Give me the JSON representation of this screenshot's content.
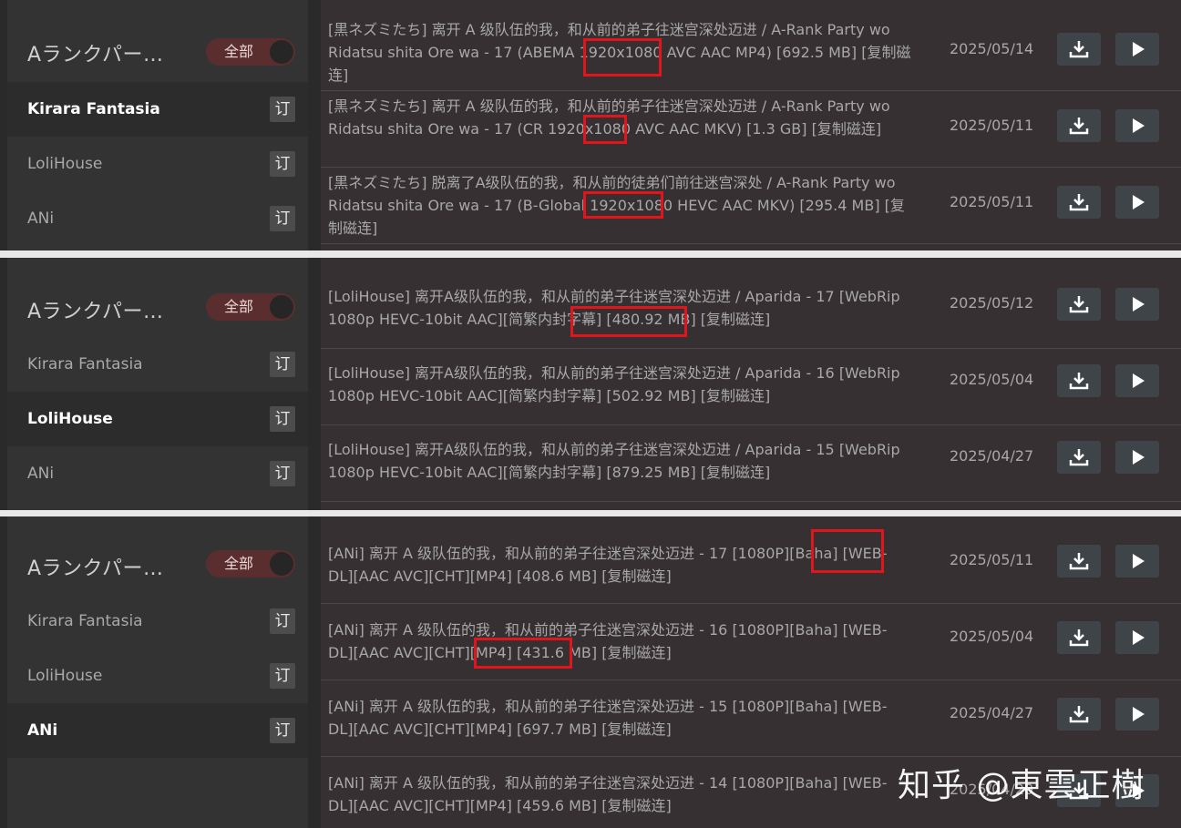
{
  "panels": [
    {
      "sidebar": {
        "title": "Aランクパー…",
        "toggle_label": "全部",
        "items": [
          {
            "label": "Kirara Fantasia",
            "sub": "订"
          },
          {
            "label": "LoliHouse",
            "sub": "订"
          },
          {
            "label": "ANi",
            "sub": "订"
          }
        ],
        "active_index": 0
      },
      "rows": [
        {
          "title": "[黒ネズミたち] 离开 A 级队伍的我，和从前的弟子往迷宫深处迈进 / A-Rank Party wo Ridatsu shita Ore wa - 17 (ABEMA 1920x1080 AVC AAC MP4) [692.5 MB] [复制磁连]",
          "date": "2025/05/14"
        },
        {
          "title": "[黒ネズミたち] 离开 A 级队伍的我，和从前的弟子往迷宫深处迈进 / A-Rank Party wo Ridatsu shita Ore wa - 17 (CR 1920x1080 AVC AAC MKV) [1.3 GB] [复制磁连]",
          "date": "2025/05/11"
        },
        {
          "title": "[黒ネズミたち] 脱离了A级队伍的我，和从前的徒弟们前往迷宫深处 / A-Rank Party wo Ridatsu shita Ore wa - 17 (B-Global 1920x1080 HEVC AAC MKV) [295.4 MB] [复制磁连]",
          "date": "2025/05/11"
        }
      ]
    },
    {
      "sidebar": {
        "title": "Aランクパー…",
        "toggle_label": "全部",
        "items": [
          {
            "label": "Kirara Fantasia",
            "sub": "订"
          },
          {
            "label": "LoliHouse",
            "sub": "订"
          },
          {
            "label": "ANi",
            "sub": "订"
          }
        ],
        "active_index": 1
      },
      "rows": [
        {
          "title": "[LoliHouse] 离开A级队伍的我，和从前的弟子往迷宫深处迈进 / Aparida - 17 [WebRip 1080p HEVC-10bit AAC][简繁内封字幕] [480.92 MB] [复制磁连]",
          "date": "2025/05/12"
        },
        {
          "title": "[LoliHouse] 离开A级队伍的我，和从前的弟子往迷宫深处迈进 / Aparida - 16 [WebRip 1080p HEVC-10bit AAC][简繁内封字幕] [502.92 MB] [复制磁连]",
          "date": "2025/05/04"
        },
        {
          "title": "[LoliHouse] 离开A级队伍的我，和从前的弟子往迷宫深处迈进 / Aparida - 15 [WebRip 1080p HEVC-10bit AAC][简繁内封字幕] [879.25 MB] [复制磁连]",
          "date": "2025/04/27"
        }
      ]
    },
    {
      "sidebar": {
        "title": "Aランクパー…",
        "toggle_label": "全部",
        "items": [
          {
            "label": "Kirara Fantasia",
            "sub": "订"
          },
          {
            "label": "LoliHouse",
            "sub": "订"
          },
          {
            "label": "ANi",
            "sub": "订"
          }
        ],
        "active_index": 2
      },
      "rows": [
        {
          "title": "[ANi] 离开 A 级队伍的我，和从前的弟子往迷宫深处迈进 - 17 [1080P][Baha] [WEB-DL][AAC AVC][CHT][MP4] [408.6 MB] [复制磁连]",
          "date": "2025/05/11"
        },
        {
          "title": "[ANi] 离开 A 级队伍的我，和从前的弟子往迷宫深处迈进 - 16 [1080P][Baha] [WEB-DL][AAC AVC][CHT][MP4] [431.6 MB] [复制磁连]",
          "date": "2025/05/04"
        },
        {
          "title": "[ANi] 离开 A 级队伍的我，和从前的弟子往迷宫深处迈进 - 15 [1080P][Baha] [WEB-DL][AAC AVC][CHT][MP4] [697.7 MB] [复制磁连]",
          "date": "2025/04/27"
        },
        {
          "title": "[ANi] 离开 A 级队伍的我，和从前的弟子往迷宫深处迈进 - 14 [1080P][Baha] [WEB-DL][AAC AVC][CHT][MP4] [459.6 MB] [复制磁连]",
          "date": "2025/04/20"
        }
      ]
    }
  ],
  "icons": {
    "download": "download-icon",
    "play": "play-icon"
  },
  "colors": {
    "highlight": "#e0161c",
    "toggle_bg": "#5a2e2e",
    "panel_bg": "#2a2a2a"
  },
  "watermark": "知乎 @東雲正樹"
}
